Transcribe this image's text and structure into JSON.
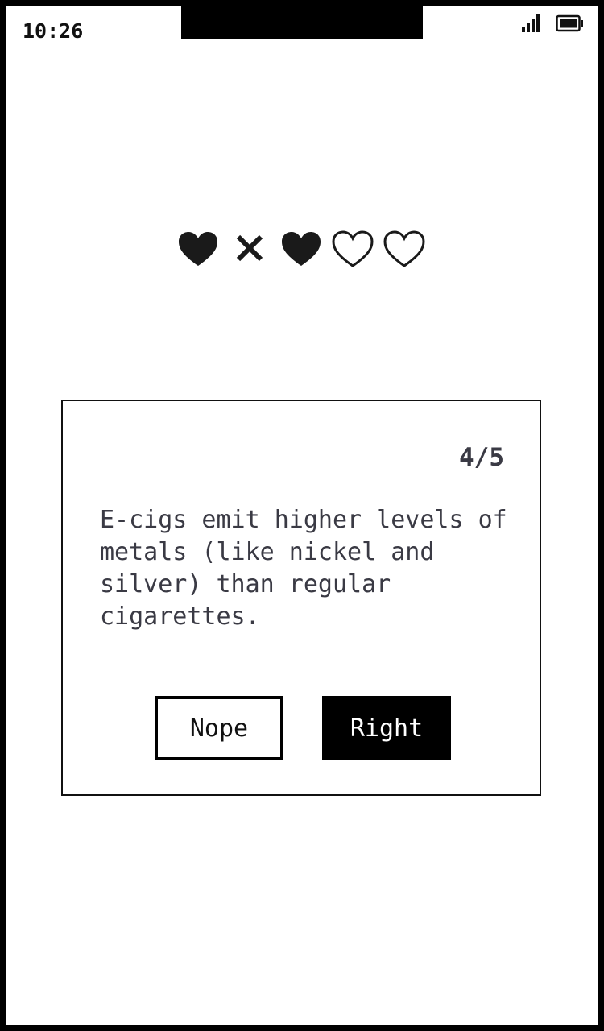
{
  "status_bar": {
    "time": "10:26",
    "signal_icon": "cellular-signal-icon",
    "battery_icon": "battery-full-icon"
  },
  "lives": {
    "results": [
      "correct",
      "wrong",
      "correct",
      "pending",
      "pending"
    ],
    "icons": [
      "heart-filled-icon",
      "x-mark-icon",
      "heart-filled-icon",
      "heart-outline-icon",
      "heart-outline-icon"
    ]
  },
  "quiz": {
    "progress": "4/5",
    "statement": "E-cigs emit higher levels of metals (like nickel and silver) than regular cigarettes.",
    "nope_label": "Nope",
    "right_label": "Right"
  },
  "colors": {
    "ink": "#111111",
    "text_gray": "#3a3a44",
    "background": "#ffffff",
    "frame": "#000000"
  }
}
